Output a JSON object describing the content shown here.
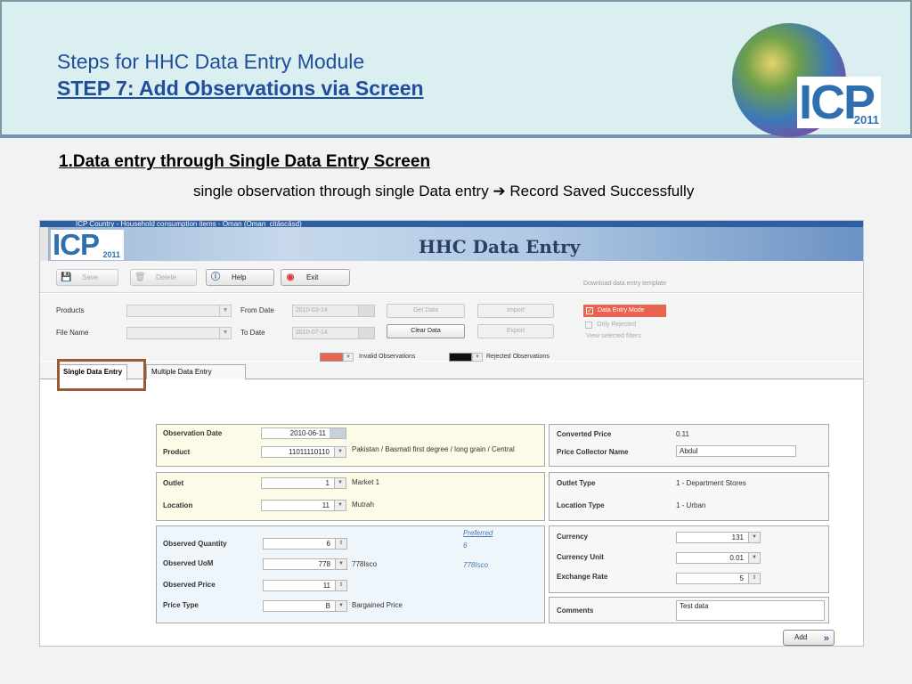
{
  "slide": {
    "title_line1": "Steps for HHC Data Entry Module",
    "title_line2": "STEP 7: Add Observations via  Screen",
    "logo_text": "ICP",
    "logo_year": "2011",
    "heading": "1.Data entry through Single Data Entry Screen",
    "subheading": "single observation through single Data entry ➔ Record Saved Successfully"
  },
  "app": {
    "window_title": "ICP Country - Household consumption items - Oman (Oman_citāscāsd)",
    "banner_title": "HHC Data Entry",
    "logo_text": "ICP",
    "logo_year": "2011",
    "toolbar": {
      "save": "Save",
      "delete": "Delete",
      "help": "Help",
      "exit": "Exit",
      "download_link": "Download data entry template"
    },
    "filters": {
      "products_label": "Products",
      "file_name_label": "File Name",
      "from_date_label": "From Date",
      "from_date_value": "2010-03-14",
      "to_date_label": "To Date",
      "to_date_value": "2010-07-14",
      "get_data": "Get Data",
      "clear_data": "Clear Data",
      "import": "Import",
      "export": "Export",
      "data_entry_mode": "Data Entry Mode",
      "only_rejected": "Only Rejected",
      "view_selected_filters": "View selected filters",
      "invalid_observations": "Invalid Observations",
      "rejected_observations": "Rejected Observations"
    },
    "tabs": {
      "single": "Single Data Entry",
      "multiple": "Multiple Data Entry"
    },
    "form": {
      "observation_date_label": "Observation Date",
      "observation_date_value": "2010-06-11",
      "product_label": "Product",
      "product_code": "11011110110",
      "product_desc": "Pakistan / Basmati first degree / long grain / Central",
      "converted_price_label": "Converted Price",
      "converted_price_value": "0.11",
      "price_collector_label": "Price Collector Name",
      "price_collector_value": "Abdul",
      "outlet_label": "Outlet",
      "outlet_value": "1",
      "outlet_desc": "Market 1",
      "location_label": "Location",
      "location_value": "11",
      "location_desc": "Mutrah",
      "outlet_type_label": "Outlet Type",
      "outlet_type_value": "1 - Department Stores",
      "location_type_label": "Location Type",
      "location_type_value": "1 - Urban",
      "preferred_label": "Preferred",
      "preferred_value": "6",
      "preferred_uom": "778Isco",
      "observed_quantity_label": "Observed Quantity",
      "observed_quantity_value": "6",
      "observed_uom_label": "Observed UoM",
      "observed_uom_value": "778",
      "observed_uom_desc": "778Isco",
      "observed_price_label": "Observed Price",
      "observed_price_value": "11",
      "price_type_label": "Price Type",
      "price_type_value": "B",
      "price_type_desc": "Bargained Price",
      "currency_label": "Currency",
      "currency_value": "131",
      "currency_unit_label": "Currency Unit",
      "currency_unit_value": "0.01",
      "exchange_rate_label": "Exchange Rate",
      "exchange_rate_value": "5",
      "comments_label": "Comments",
      "comments_value": "Test data",
      "add_button": "Add"
    }
  },
  "colors": {
    "title_blue": "#1f4e9c",
    "invalid_swatch": "#e8644f",
    "rejected_swatch": "#111111",
    "highlight_box": "#9a5b32"
  }
}
